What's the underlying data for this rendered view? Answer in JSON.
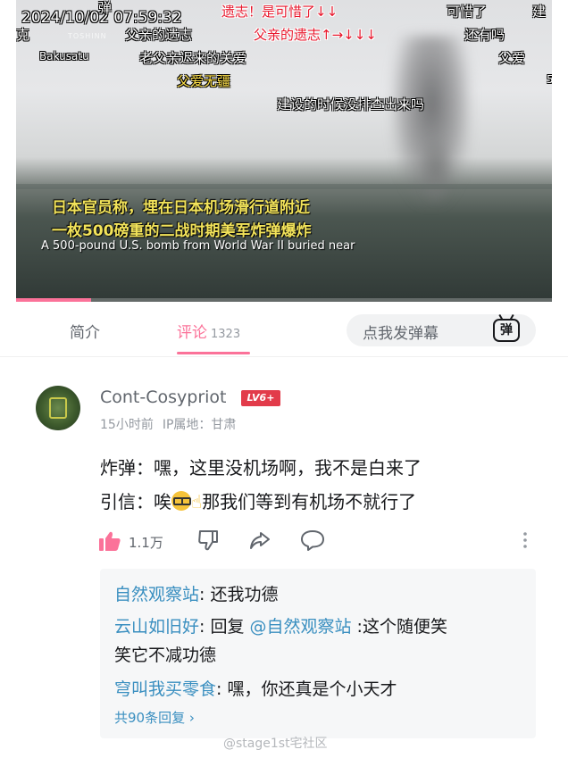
{
  "video": {
    "timestamp": "2024/10/02   07:59:32",
    "channel_logo": "TOSHINN",
    "danmaku": [
      {
        "text": "弹",
        "color": "white"
      },
      {
        "text": "克",
        "color": "white"
      },
      {
        "text": "父亲的遗志",
        "color": "white"
      },
      {
        "text": "遗志！是可惜了↓↓",
        "color": "red"
      },
      {
        "text": "可惜了",
        "color": "white"
      },
      {
        "text": "建",
        "color": "white"
      },
      {
        "text": "父亲的遗志↑→↓↓↓",
        "color": "red"
      },
      {
        "text": "还有吗",
        "color": "white"
      },
      {
        "text": "Bakusatu",
        "color": "white"
      },
      {
        "text": "老父亲迟来的关爱",
        "color": "white"
      },
      {
        "text": "父爱",
        "color": "white"
      },
      {
        "text": "父爱无疆",
        "color": "yellow"
      },
      {
        "text": "建设的时候没排查出来吗",
        "color": "white"
      },
      {
        "text": "5",
        "color": "white"
      }
    ],
    "subtitle_zh_line1": "日本官员称，埋在日本机场滑行道附近",
    "subtitle_zh_line2": "一枚500磅重的二战时期美军炸弹爆炸",
    "subtitle_en": "A 500-pound U.S. bomb from World War II buried near",
    "progress_fraction": 0.14
  },
  "tabs": {
    "intro_label": "简介",
    "comments_label": "评论",
    "comments_count": "1323",
    "danmaku_placeholder": "点我发弹幕",
    "danmaku_icon_glyph": "弹"
  },
  "comment": {
    "username": "Cont-Cosypriot",
    "level_badge": "LV6+",
    "time": "15小时前",
    "ip_location": "IP属地：甘肃",
    "line1": "炸弹：嘿，这里没机场啊，我不是白来了",
    "line2_before": "引信：唉",
    "line2_after": "那我们等到有机场不就行了",
    "likes": "1.1万",
    "icons": [
      "thumb-up-icon",
      "thumb-down-icon",
      "share-icon",
      "reply-bubble-icon",
      "more-vertical-icon"
    ]
  },
  "replies": {
    "items": [
      {
        "author": "自然观察站",
        "text": ": 还我功德"
      },
      {
        "author": "云山如旧好",
        "text_before": ": 回复 ",
        "mention": "@自然观察站",
        "text_after": " :这个随便笑",
        "continuation": "笑它不减功德"
      },
      {
        "author": "穹叫我买零食",
        "text": ": 嘿，你还真是个小天才"
      }
    ],
    "more_label": "共90条回复 ›"
  },
  "source_watermark": "@stage1st宅社区",
  "colors": {
    "accent_pink": "#fb7299",
    "link_blue": "#3a8fc0",
    "level_red": "#e23b4a",
    "danmaku_red": "#e8172c"
  }
}
